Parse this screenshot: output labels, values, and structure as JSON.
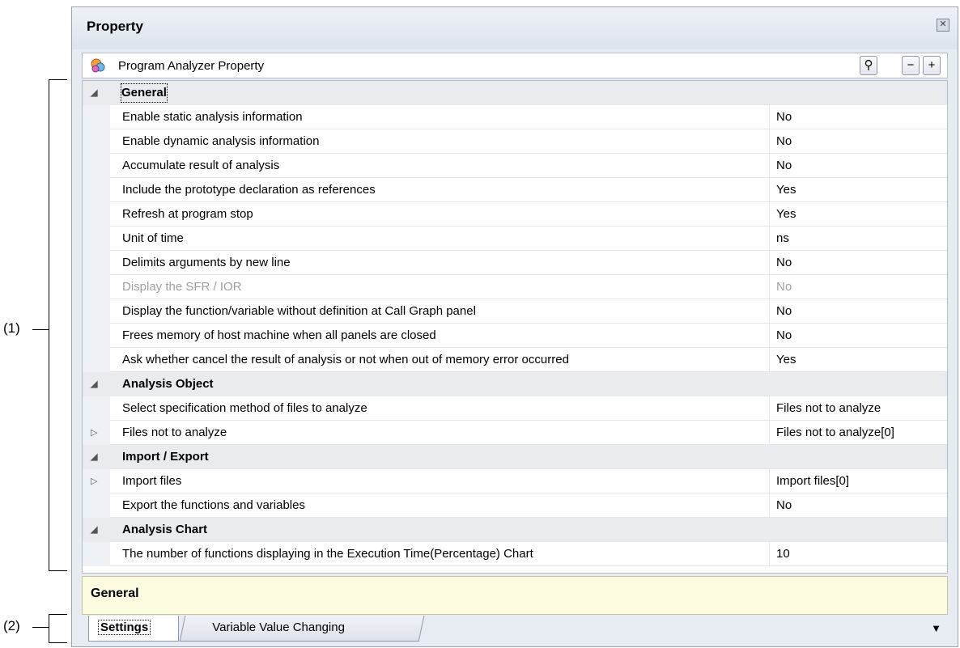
{
  "callouts": {
    "one": "(1)",
    "two": "(2)"
  },
  "window": {
    "title": "Property",
    "close_glyph": "✕",
    "toolbar": {
      "title": "Program Analyzer Property",
      "icon": "program-analyzer-icon",
      "search_glyph": "⚲",
      "collapse_glyph": "−",
      "expand_glyph": "+"
    }
  },
  "grid": {
    "rows": [
      {
        "type": "category",
        "expander": "◢",
        "name": "General"
      },
      {
        "type": "property",
        "name": "Enable static analysis information",
        "value": "No"
      },
      {
        "type": "property",
        "name": "Enable dynamic analysis information",
        "value": "No"
      },
      {
        "type": "property",
        "name": "Accumulate result of analysis",
        "value": "No"
      },
      {
        "type": "property",
        "name": "Include the prototype declaration as references",
        "value": "Yes"
      },
      {
        "type": "property",
        "name": "Refresh at program stop",
        "value": "Yes"
      },
      {
        "type": "property",
        "name": "Unit of time",
        "value": "ns"
      },
      {
        "type": "property",
        "name": "Delimits arguments by new line",
        "value": "No"
      },
      {
        "type": "property",
        "name": "Display the SFR / IOR",
        "value": "No",
        "disabled": true
      },
      {
        "type": "property",
        "name": "Display the function/variable without definition at Call Graph panel",
        "value": "No"
      },
      {
        "type": "property",
        "name": "Frees memory of host machine when all panels are closed",
        "value": "No"
      },
      {
        "type": "property",
        "name": "Ask whether cancel the result of analysis or not when out of memory error occurred",
        "value": "Yes"
      },
      {
        "type": "category",
        "expander": "◢",
        "name": "Analysis Object"
      },
      {
        "type": "property",
        "name": "Select specification method of files to analyze",
        "value": "Files not to analyze"
      },
      {
        "type": "property",
        "expander": "▷",
        "name": "Files not to analyze",
        "value": "Files not to analyze[0]"
      },
      {
        "type": "category",
        "expander": "◢",
        "name": "Import / Export"
      },
      {
        "type": "property",
        "expander": "▷",
        "name": "Import files",
        "value": "Import files[0]"
      },
      {
        "type": "property",
        "name": "Export the functions and variables",
        "value": "No"
      },
      {
        "type": "category",
        "expander": "◢",
        "name": "Analysis Chart"
      },
      {
        "type": "property",
        "name": "The number of functions displaying in the Execution Time(Percentage) Chart",
        "value": "10"
      }
    ]
  },
  "description": {
    "title": "General"
  },
  "tabs": {
    "active": "Settings",
    "inactive": "Variable Value Changing",
    "dropdown_glyph": "▼"
  }
}
